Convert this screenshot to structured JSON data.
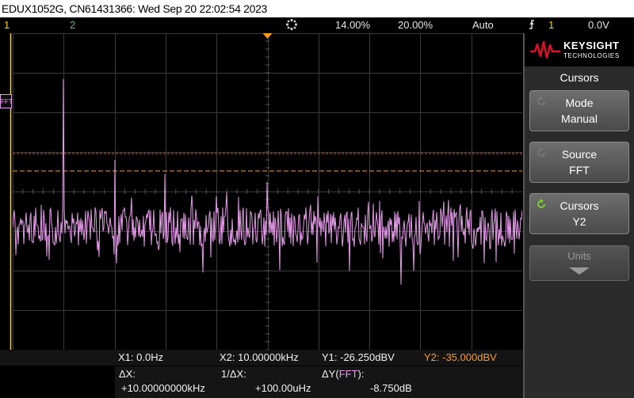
{
  "title": "EDUX1052G, CN61431366: Wed Sep 20 22:02:54 2023",
  "status": {
    "ch1_label": "1",
    "ch2_label": "2",
    "time_scale": "14.00%",
    "sample_rate": "20.00%",
    "trigger_mode": "Auto",
    "trigger_source": "1",
    "trigger_level": "0.0V"
  },
  "fft_marker": "FFT",
  "panel": {
    "brand": "KEYSIGHT",
    "brand_sub": "TECHNOLOGIES",
    "menu_title": "Cursors",
    "softkeys": [
      {
        "line1": "Mode",
        "line2": "Manual"
      },
      {
        "line1": "Source",
        "line2": "FFT"
      },
      {
        "line1": "Cursors",
        "line2": "Y2"
      },
      {
        "line1": "Units",
        "line2": ""
      }
    ]
  },
  "readout": {
    "x1": "X1:  0.0Hz",
    "x2": "X2:  10.00000kHz",
    "y1": "Y1: -26.250dBV",
    "y2": "Y2: -35.000dBV",
    "dx_label": "ΔX:",
    "dx_value": "+10.00000000kHz",
    "inv_dx_label": "1/ΔX:",
    "inv_dx_value": "+100.00uHz",
    "dy_label": "ΔY(",
    "dy_fft": "FFT",
    "dy_close": "):",
    "dy_value": "-8.750dB"
  },
  "colors": {
    "fft_trace": "#e59be9",
    "cursor_line": "#ff9a1e",
    "ch1": "#ffd400",
    "ch2": "#3fd33f"
  }
}
